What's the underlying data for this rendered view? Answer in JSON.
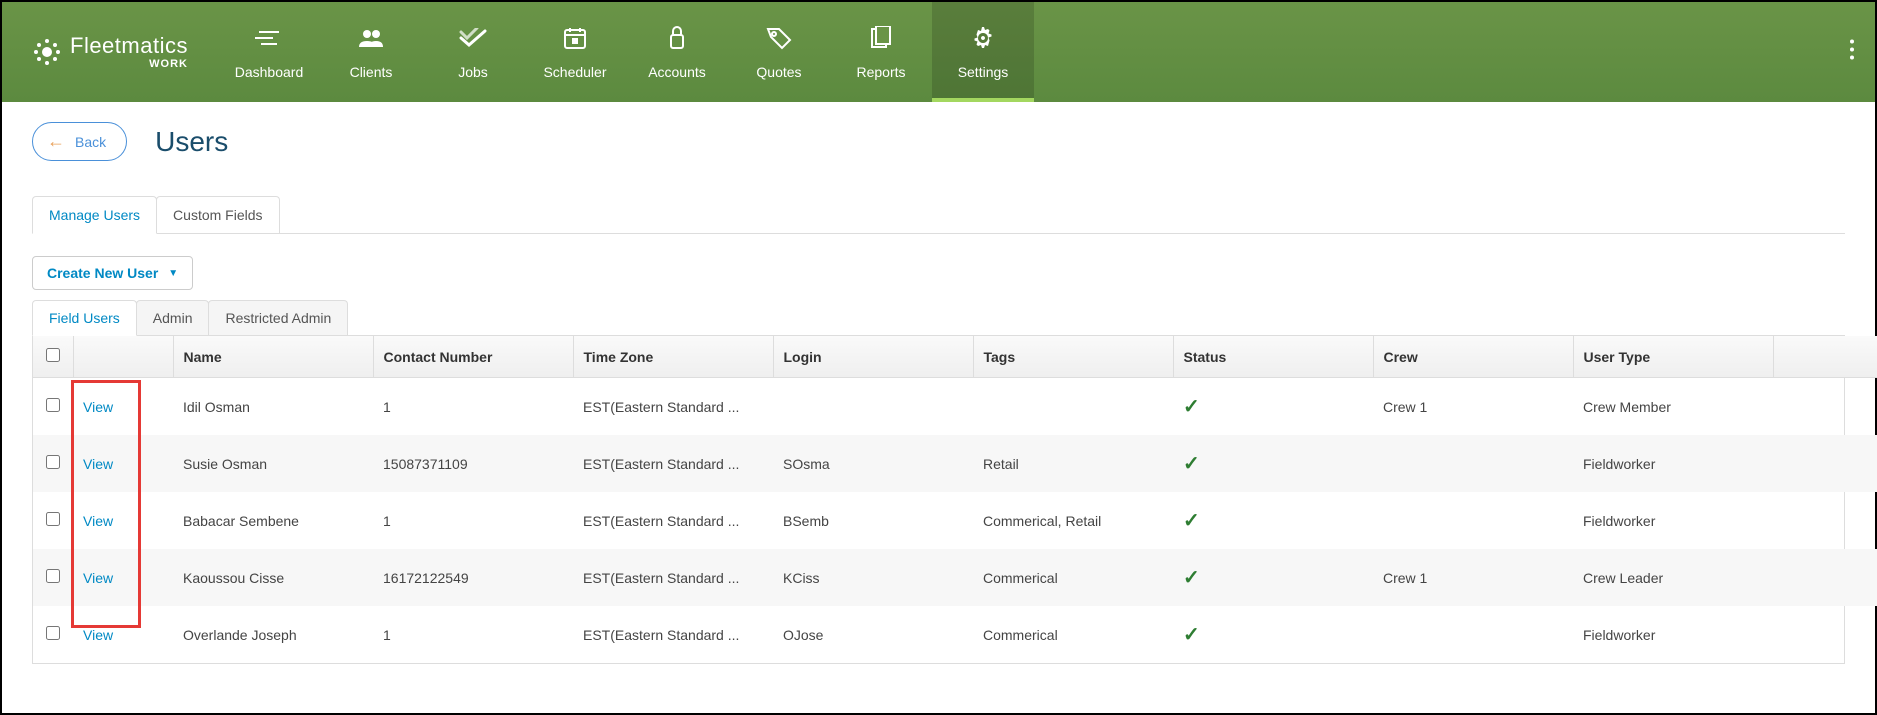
{
  "logo": {
    "text": "Fleetmatics",
    "sub": "WORK"
  },
  "nav": [
    {
      "key": "dashboard",
      "label": "Dashboard"
    },
    {
      "key": "clients",
      "label": "Clients"
    },
    {
      "key": "jobs",
      "label": "Jobs"
    },
    {
      "key": "scheduler",
      "label": "Scheduler"
    },
    {
      "key": "accounts",
      "label": "Accounts"
    },
    {
      "key": "quotes",
      "label": "Quotes"
    },
    {
      "key": "reports",
      "label": "Reports"
    },
    {
      "key": "settings",
      "label": "Settings",
      "active": true
    }
  ],
  "back_label": "Back",
  "page_title": "Users",
  "tabs": {
    "manage_users": "Manage Users",
    "custom_fields": "Custom Fields"
  },
  "create_btn": "Create New User",
  "sub_tabs": {
    "field_users": "Field Users",
    "admin": "Admin",
    "restricted_admin": "Restricted Admin"
  },
  "columns": {
    "name": "Name",
    "contact": "Contact Number",
    "timezone": "Time Zone",
    "login": "Login",
    "tags": "Tags",
    "status": "Status",
    "crew": "Crew",
    "user_type": "User Type"
  },
  "view_label": "View",
  "rows": [
    {
      "name": "Idil Osman",
      "contact": "1",
      "timezone": "EST(Eastern Standard ...",
      "login": "",
      "tags": "",
      "status": true,
      "crew": "Crew 1",
      "user_type": "Crew Member"
    },
    {
      "name": "Susie Osman",
      "contact": "15087371109",
      "timezone": "EST(Eastern Standard ...",
      "login": "SOsma",
      "tags": "Retail",
      "status": true,
      "crew": "",
      "user_type": "Fieldworker"
    },
    {
      "name": "Babacar Sembene",
      "contact": "1",
      "timezone": "EST(Eastern Standard ...",
      "login": "BSemb",
      "tags": "Commerical, Retail",
      "status": true,
      "crew": "",
      "user_type": "Fieldworker"
    },
    {
      "name": "Kaoussou Cisse",
      "contact": "16172122549",
      "timezone": "EST(Eastern Standard ...",
      "login": "KCiss",
      "tags": "Commerical",
      "status": true,
      "crew": "Crew 1",
      "user_type": "Crew Leader"
    },
    {
      "name": "Overlande Joseph",
      "contact": "1",
      "timezone": "EST(Eastern Standard ...",
      "login": "OJose",
      "tags": "Commerical",
      "status": true,
      "crew": "",
      "user_type": "Fieldworker"
    }
  ]
}
